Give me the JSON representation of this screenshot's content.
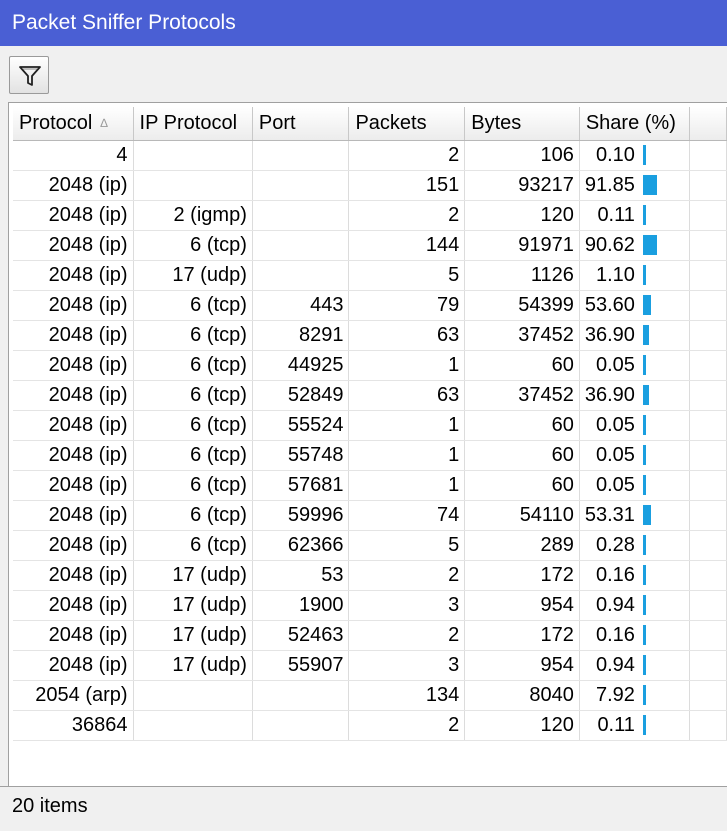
{
  "window": {
    "title": "Packet Sniffer Protocols"
  },
  "toolbar": {
    "filter_icon": "filter-icon"
  },
  "table": {
    "columns": [
      "Protocol",
      "IP Protocol",
      "Port",
      "Packets",
      "Bytes",
      "Share (%)"
    ],
    "sort_indicator": "∆",
    "rows": [
      {
        "protocol": "4",
        "ip_protocol": "",
        "port": "",
        "packets": "2",
        "bytes": "106",
        "share": "0.10"
      },
      {
        "protocol": "2048 (ip)",
        "ip_protocol": "",
        "port": "",
        "packets": "151",
        "bytes": "93217",
        "share": "91.85"
      },
      {
        "protocol": "2048 (ip)",
        "ip_protocol": "2 (igmp)",
        "port": "",
        "packets": "2",
        "bytes": "120",
        "share": "0.11"
      },
      {
        "protocol": "2048 (ip)",
        "ip_protocol": "6 (tcp)",
        "port": "",
        "packets": "144",
        "bytes": "91971",
        "share": "90.62"
      },
      {
        "protocol": "2048 (ip)",
        "ip_protocol": "17 (udp)",
        "port": "",
        "packets": "5",
        "bytes": "1126",
        "share": "1.10"
      },
      {
        "protocol": "2048 (ip)",
        "ip_protocol": "6 (tcp)",
        "port": "443",
        "packets": "79",
        "bytes": "54399",
        "share": "53.60"
      },
      {
        "protocol": "2048 (ip)",
        "ip_protocol": "6 (tcp)",
        "port": "8291",
        "packets": "63",
        "bytes": "37452",
        "share": "36.90"
      },
      {
        "protocol": "2048 (ip)",
        "ip_protocol": "6 (tcp)",
        "port": "44925",
        "packets": "1",
        "bytes": "60",
        "share": "0.05"
      },
      {
        "protocol": "2048 (ip)",
        "ip_protocol": "6 (tcp)",
        "port": "52849",
        "packets": "63",
        "bytes": "37452",
        "share": "36.90"
      },
      {
        "protocol": "2048 (ip)",
        "ip_protocol": "6 (tcp)",
        "port": "55524",
        "packets": "1",
        "bytes": "60",
        "share": "0.05"
      },
      {
        "protocol": "2048 (ip)",
        "ip_protocol": "6 (tcp)",
        "port": "55748",
        "packets": "1",
        "bytes": "60",
        "share": "0.05"
      },
      {
        "protocol": "2048 (ip)",
        "ip_protocol": "6 (tcp)",
        "port": "57681",
        "packets": "1",
        "bytes": "60",
        "share": "0.05"
      },
      {
        "protocol": "2048 (ip)",
        "ip_protocol": "6 (tcp)",
        "port": "59996",
        "packets": "74",
        "bytes": "54110",
        "share": "53.31"
      },
      {
        "protocol": "2048 (ip)",
        "ip_protocol": "6 (tcp)",
        "port": "62366",
        "packets": "5",
        "bytes": "289",
        "share": "0.28"
      },
      {
        "protocol": "2048 (ip)",
        "ip_protocol": "17 (udp)",
        "port": "53",
        "packets": "2",
        "bytes": "172",
        "share": "0.16"
      },
      {
        "protocol": "2048 (ip)",
        "ip_protocol": "17 (udp)",
        "port": "1900",
        "packets": "3",
        "bytes": "954",
        "share": "0.94"
      },
      {
        "protocol": "2048 (ip)",
        "ip_protocol": "17 (udp)",
        "port": "52463",
        "packets": "2",
        "bytes": "172",
        "share": "0.16"
      },
      {
        "protocol": "2048 (ip)",
        "ip_protocol": "17 (udp)",
        "port": "55907",
        "packets": "3",
        "bytes": "954",
        "share": "0.94"
      },
      {
        "protocol": "2054 (arp)",
        "ip_protocol": "",
        "port": "",
        "packets": "134",
        "bytes": "8040",
        "share": "7.92"
      },
      {
        "protocol": "36864",
        "ip_protocol": "",
        "port": "",
        "packets": "2",
        "bytes": "120",
        "share": "0.11"
      }
    ]
  },
  "status": {
    "items_text": "20 items"
  },
  "colors": {
    "title_bar": "#4a5fd4",
    "share_bar": "#1a9fe0"
  }
}
